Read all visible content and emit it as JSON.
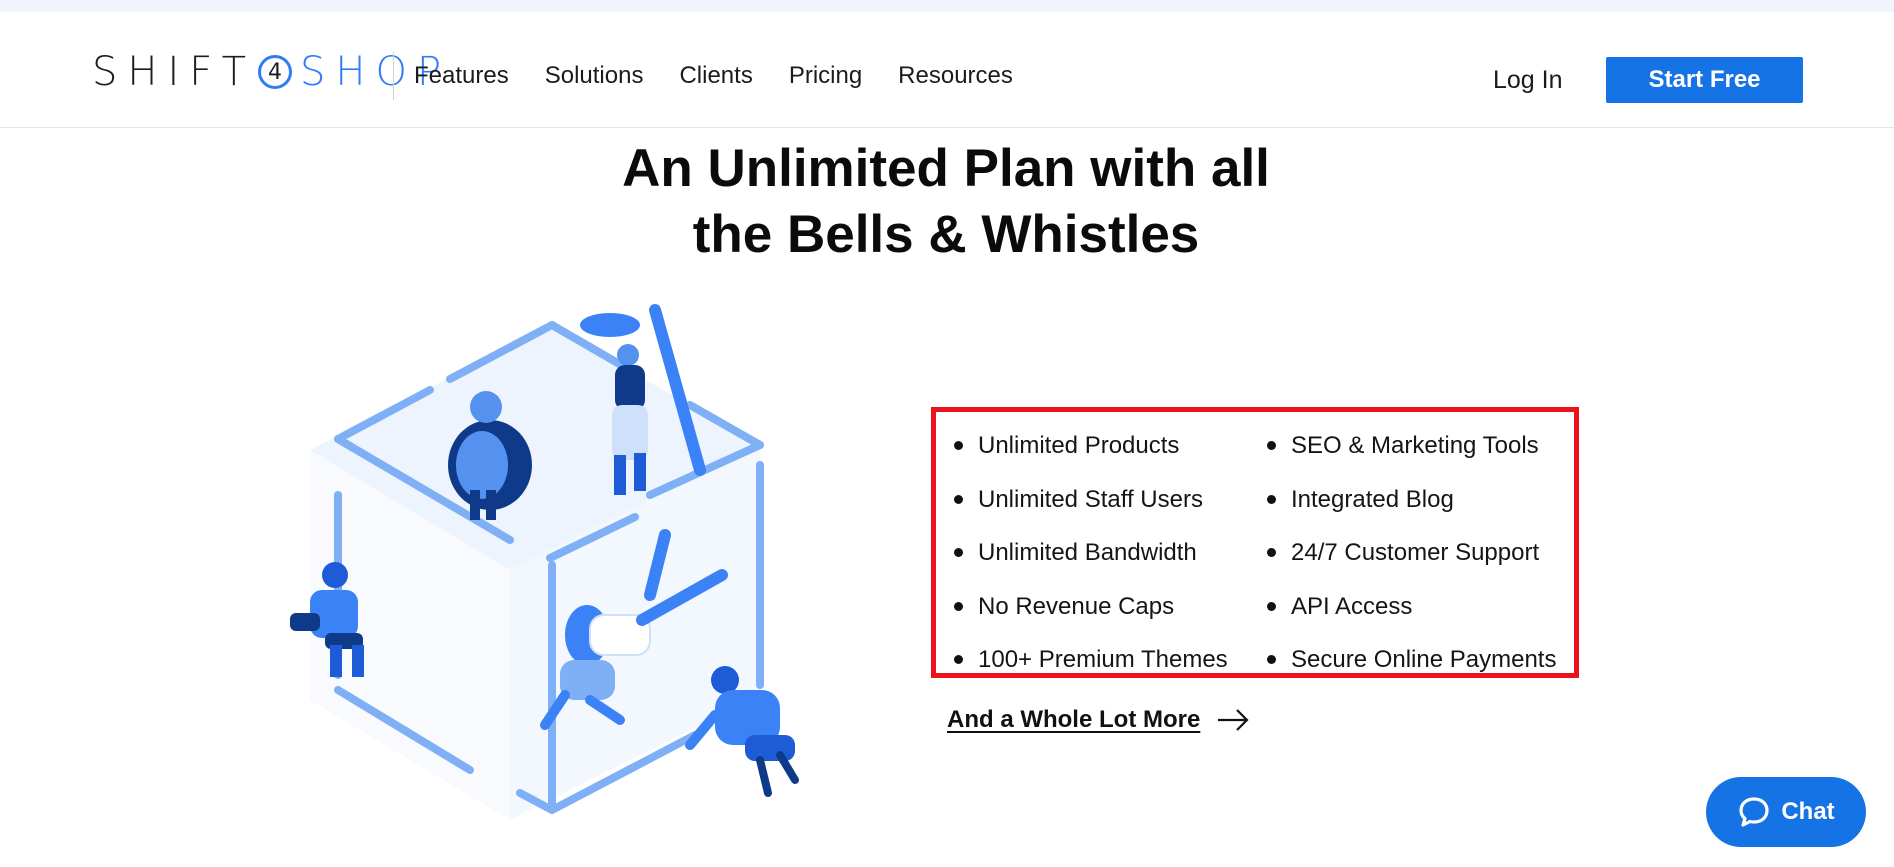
{
  "header": {
    "logo": {
      "part1": "SHIFT",
      "mark": "4",
      "part2": "SHOP"
    },
    "nav": [
      {
        "label": "Features"
      },
      {
        "label": "Solutions"
      },
      {
        "label": "Clients"
      },
      {
        "label": "Pricing"
      },
      {
        "label": "Resources"
      }
    ],
    "login_label": "Log In",
    "cta_label": "Start Free"
  },
  "hero": {
    "title_line1": "An Unlimited Plan with all",
    "title_line2": "the Bells & Whistles"
  },
  "features": {
    "left": [
      "Unlimited Products",
      "Unlimited Staff Users",
      "Unlimited Bandwidth",
      "No Revenue Caps",
      "100+ Premium Themes"
    ],
    "right": [
      "SEO & Marketing Tools",
      "Integrated Blog",
      "24/7 Customer Support",
      "API Access",
      "Secure Online Payments"
    ],
    "more_link": "And a Whole Lot More"
  },
  "chat": {
    "label": "Chat"
  },
  "colors": {
    "brand_blue": "#1573e6",
    "logo_blue": "#2f7cf6",
    "highlight_red": "#e8131b",
    "illustration_light": "#7fb0f5",
    "illustration_dark": "#0f3a8a"
  },
  "icons": [
    "logo-four-circle",
    "arrow-right-icon",
    "chat-bubble-icon"
  ]
}
